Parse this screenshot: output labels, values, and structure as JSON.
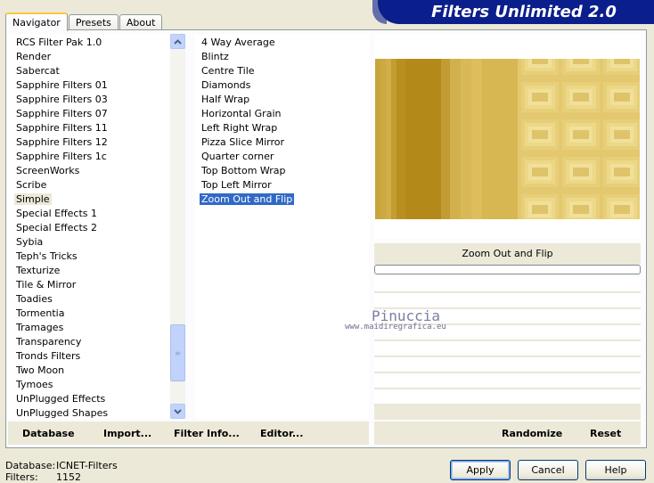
{
  "window": {
    "title": "Filters Unlimited 2.0"
  },
  "tabs": [
    {
      "label": "Navigator",
      "active": true
    },
    {
      "label": "Presets",
      "active": false
    },
    {
      "label": "About",
      "active": false
    }
  ],
  "categories": [
    "RCS Filter Pak 1.0",
    "Render",
    "Sabercat",
    "Sapphire Filters 01",
    "Sapphire Filters 03",
    "Sapphire Filters 07",
    "Sapphire Filters 11",
    "Sapphire Filters 12",
    "Sapphire Filters 1c",
    "ScreenWorks",
    "Scribe",
    "Simple",
    "Special Effects 1",
    "Special Effects 2",
    "Sybia",
    "Teph's Tricks",
    "Texturize",
    "Tile & Mirror",
    "Toadies",
    "Tormentia",
    "Tramages",
    "Transparency",
    "Tronds Filters",
    "Two Moon",
    "Tymoes",
    "UnPlugged Effects",
    "UnPlugged Shapes"
  ],
  "selected_category": "Simple",
  "filters": [
    "4 Way Average",
    "Blintz",
    "Centre Tile",
    "Diamonds",
    "Half Wrap",
    "Horizontal Grain",
    "Left Right Wrap",
    "Pizza Slice Mirror",
    "Quarter corner",
    "Top Bottom Wrap",
    "Top Left Mirror",
    "Zoom Out and Flip"
  ],
  "selected_filter": "Zoom Out and Flip",
  "preview": {
    "filter_name": "Zoom Out and Flip",
    "progress": 0
  },
  "watermark": {
    "line1": "Pinuccia",
    "line2": "www.maidiregrafica.eu"
  },
  "actions": {
    "database": "Database",
    "import": "Import...",
    "filter_info": "Filter Info...",
    "editor": "Editor...",
    "randomize": "Randomize",
    "reset": "Reset"
  },
  "status": {
    "database_label": "Database:",
    "database_value": "ICNET-Filters",
    "filters_label": "Filters:",
    "filters_value": "1152"
  },
  "buttons": {
    "apply": "Apply",
    "cancel": "Cancel",
    "help": "Help"
  },
  "colors": {
    "title_bar": "#0a1e8c",
    "selection": "#316ac5",
    "preview_gold": "#d7b752"
  }
}
